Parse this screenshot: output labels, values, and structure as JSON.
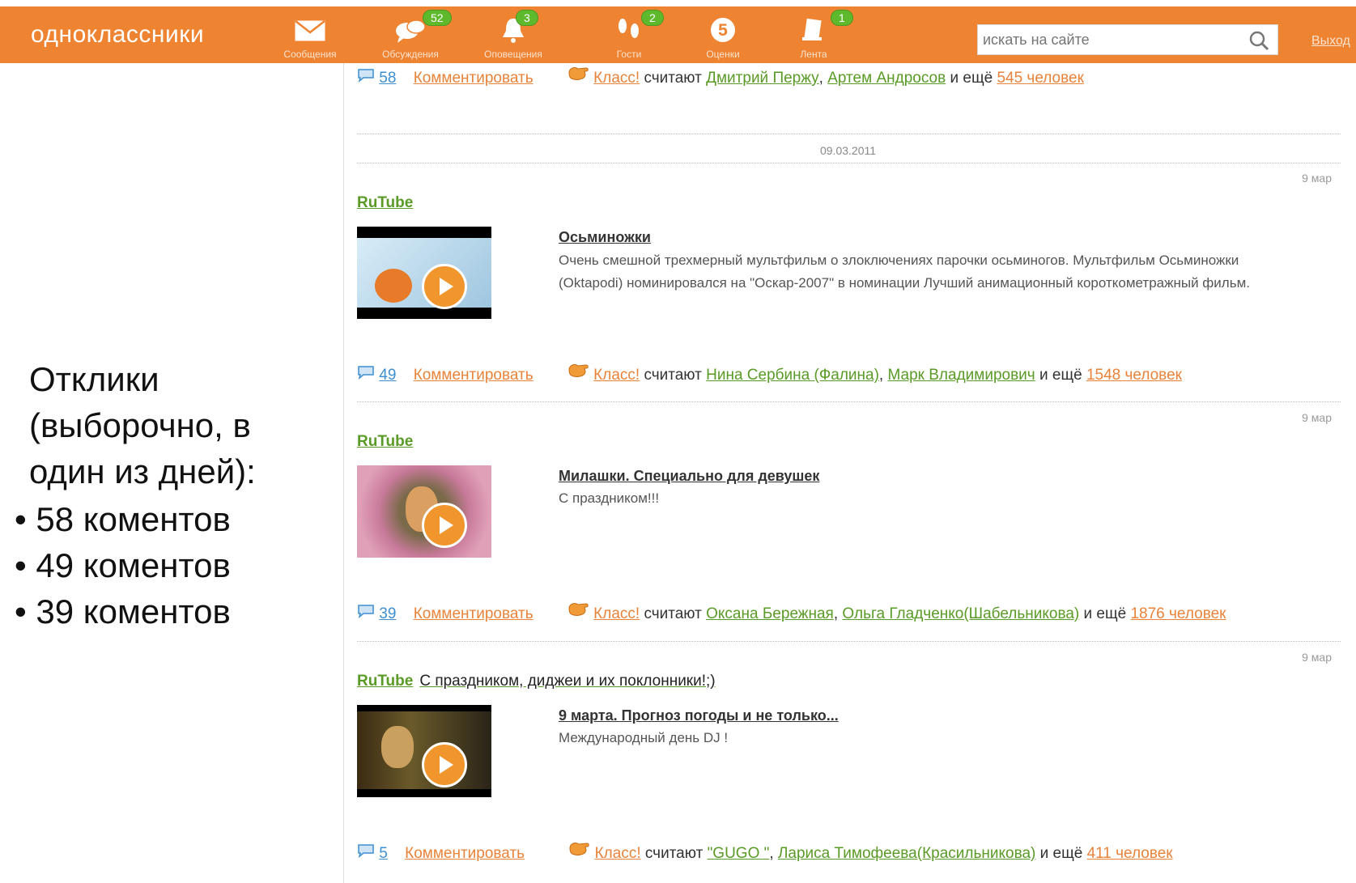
{
  "header": {
    "logo": "одноклассники",
    "nav": [
      {
        "label": "Сообщения",
        "badge": "",
        "icon": "envelope-icon"
      },
      {
        "label": "Обсуждения",
        "badge": "52",
        "icon": "speech-bubbles-icon"
      },
      {
        "label": "Оповещения",
        "badge": "3",
        "icon": "bell-icon"
      },
      {
        "label": "Гости",
        "badge": "2",
        "icon": "footprints-icon"
      },
      {
        "label": "Оценки",
        "badge": "",
        "icon": "rating-five-icon"
      },
      {
        "label": "Лента",
        "badge": "1",
        "icon": "feed-icon"
      }
    ],
    "search_placeholder": "искать на сайте",
    "exit": "Выход"
  },
  "slide": {
    "lines": [
      "Отклики",
      "(выборочно, в",
      "один из дней):"
    ],
    "bullets": [
      "• 58 коментов",
      "• 49 коментов",
      "• 39 коментов"
    ]
  },
  "feed": {
    "date": "09.03.2011",
    "comment_label": "Комментировать",
    "class_label": "Класс!",
    "consider": "считают",
    "and_more": "и ещё",
    "rating_five": "5",
    "top_actions": {
      "count": "58",
      "user1": "Дмитрий Пержу",
      "user2": "Артем Андросов",
      "more": "545 человек"
    },
    "posts": [
      {
        "ago": "9 мар",
        "source": "RuTube",
        "text": "",
        "title": "Осьминожки",
        "desc": "Очень смешной трехмерный мультфильм о злоключениях парочки осьминогов. Мультфильм Осьминожки (Oktapodi) номинировался на \"Оскар-2007\" в номинации Лучший анимационный короткометражный фильм.",
        "count": "49",
        "user1": "Нина Сербина (Фалина)",
        "user2": "Марк Владимирович",
        "more": "1548 человек"
      },
      {
        "ago": "9 мар",
        "source": "RuTube",
        "text": "",
        "title": "Милашки. Специально для девушек",
        "desc": "С праздником!!!",
        "count": "39",
        "user1": "Оксана Бережная",
        "user2": "Ольга Гладченко(Шабельникова)",
        "more": "1876 человек"
      },
      {
        "ago": "9 мар",
        "source": "RuTube",
        "text": "С праздником, диджеи и их поклонники!;)",
        "title": "9 марта. Прогноз погоды и не только...",
        "desc": "Международный день DJ !",
        "count": "5",
        "user1": "\"GUGO \"",
        "user2": "Лариса Тимофеева(Красильникова)",
        "more": "411 человек"
      }
    ]
  },
  "colors": {
    "brand": "#ee8331",
    "badge": "#5fb92d",
    "link_orange": "#e8833a",
    "link_green": "#5a9a26"
  }
}
